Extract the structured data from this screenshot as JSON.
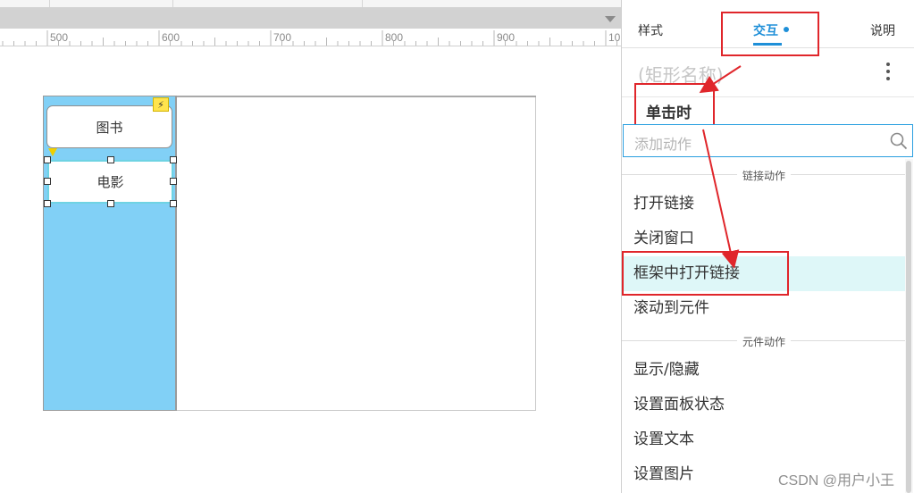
{
  "ruler": {
    "labels": [
      "500",
      "600",
      "700",
      "800",
      "900",
      "10"
    ]
  },
  "canvas": {
    "button_books": "图书",
    "button_movies": "电影",
    "interaction_badge_icon": "lightning-icon",
    "colors": {
      "panel_fill": "#81d0f6",
      "selection_border": "#6fd3e3",
      "badge": "#ffe44d"
    }
  },
  "panel": {
    "tabs": {
      "style": "样式",
      "interaction": "交互",
      "notes": "说明"
    },
    "rect_name_placeholder": "(矩形名称)",
    "event_label": "单击时",
    "search_placeholder": "添加动作",
    "sections": [
      {
        "header": "链接动作",
        "items": [
          "打开链接",
          "关闭窗口",
          "框架中打开链接",
          "滚动到元件"
        ]
      },
      {
        "header": "元件动作",
        "items": [
          "显示/隐藏",
          "设置面板状态",
          "设置文本",
          "设置图片"
        ]
      }
    ],
    "highlighted_item": "框架中打开链接",
    "colors": {
      "accent": "#1e8fd8",
      "highlight_row": "#def7f8",
      "annotation": "#e0262b"
    }
  },
  "watermark": "CSDN @用户小王"
}
